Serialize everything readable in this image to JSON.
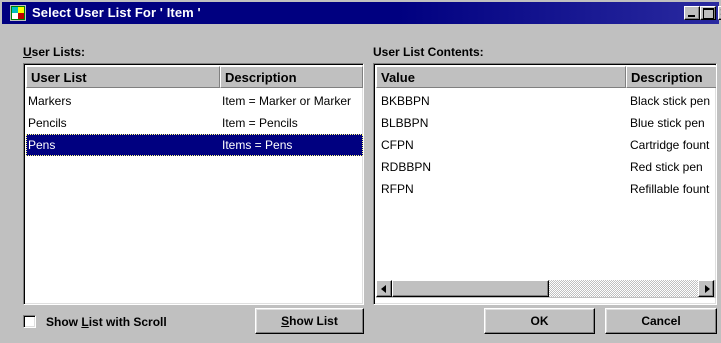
{
  "window": {
    "title": "Select User List For ' Item '",
    "controls": {
      "minimize": "minimize",
      "maximize": "maximize",
      "close": "×"
    }
  },
  "left_panel": {
    "label_mnemonic": "U",
    "label_rest": "ser Lists:",
    "columns": [
      "User List",
      "Description"
    ],
    "rows": [
      {
        "name": "Markers",
        "description": "Item = Marker or Marker",
        "selected": false
      },
      {
        "name": "Pencils",
        "description": "Item = Pencils",
        "selected": false
      },
      {
        "name": "Pens",
        "description": "Items = Pens",
        "selected": true
      }
    ]
  },
  "right_panel": {
    "label": "User List Contents:",
    "columns": [
      "Value",
      "Description"
    ],
    "rows": [
      {
        "value": "BKBBPN",
        "description": "Black stick pen"
      },
      {
        "value": "BLBBPN",
        "description": "Blue stick pen"
      },
      {
        "value": "CFPN",
        "description": "Cartridge fount"
      },
      {
        "value": "RDBBPN",
        "description": "Red stick pen"
      },
      {
        "value": "RFPN",
        "description": "Refillable fount"
      }
    ],
    "scrollbar_position": 0
  },
  "options": {
    "show_scroll": {
      "label_before": "Show ",
      "label_mnemonic": "L",
      "label_after": "ist with Scroll",
      "checked": false
    }
  },
  "buttons": {
    "show_list_mnemonic": "S",
    "show_list_rest": "how List",
    "ok": "OK",
    "cancel": "Cancel"
  },
  "colors": {
    "title_bar": "#000080",
    "selection": "#000080",
    "face": "#c0c0c0"
  }
}
